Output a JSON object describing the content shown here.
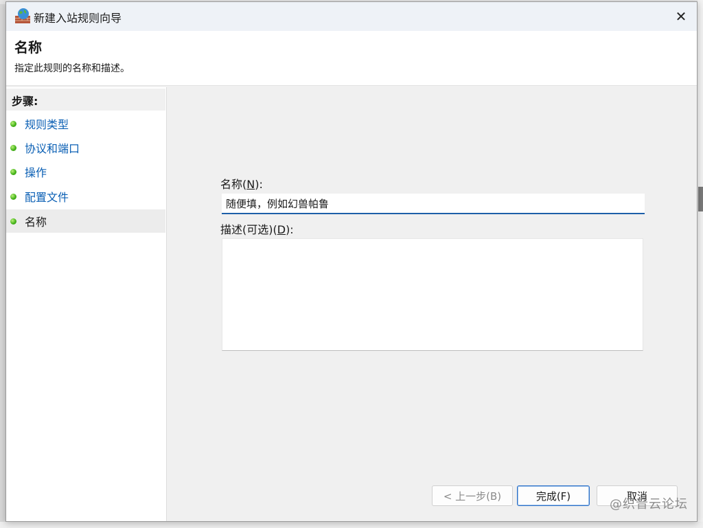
{
  "window": {
    "title": "新建入站规则向导",
    "close_glyph": "✕"
  },
  "header": {
    "title": "名称",
    "subtitle": "指定此规则的名称和描述。"
  },
  "steps": {
    "title": "步骤:",
    "items": [
      {
        "label": "规则类型"
      },
      {
        "label": "协议和端口"
      },
      {
        "label": "操作"
      },
      {
        "label": "配置文件"
      },
      {
        "label": "名称"
      }
    ]
  },
  "form": {
    "name_label": "名称(",
    "name_key": "N",
    "name_label_end": "):",
    "name_value": "随便填，例如幻兽帕鲁",
    "desc_label": "描述(可选)(",
    "desc_key": "D",
    "desc_label_end": "):",
    "desc_value": ""
  },
  "buttons": {
    "back": "< 上一步(B)",
    "finish": "完成(F)",
    "cancel": "取消"
  },
  "watermark": "@织音云论坛",
  "colors": {
    "link": "#0a5fb4",
    "input_focus": "#1d5fa8",
    "step_dot": "#47b51b"
  }
}
